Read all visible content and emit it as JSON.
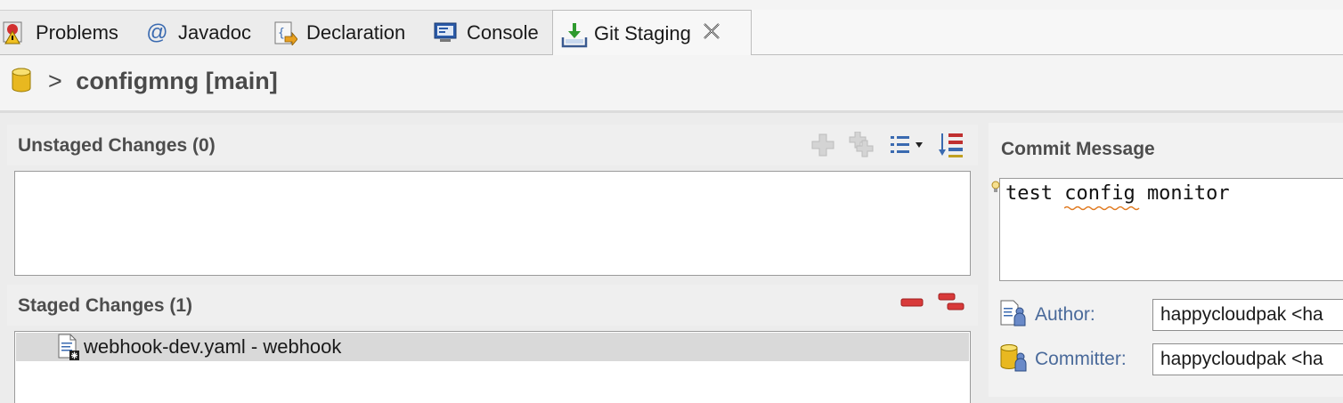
{
  "tabs": [
    {
      "label": "Problems",
      "icon": "problems-icon"
    },
    {
      "label": "Javadoc",
      "icon": "at-icon"
    },
    {
      "label": "Declaration",
      "icon": "declaration-icon"
    },
    {
      "label": "Console",
      "icon": "console-icon"
    },
    {
      "label": "Git Staging",
      "icon": "git-staging-icon",
      "active": true
    }
  ],
  "repository": {
    "arrow": ">",
    "title": "configmng [main]"
  },
  "unstaged": {
    "title": "Unstaged Changes (0)"
  },
  "staged": {
    "title": "Staged Changes (1)",
    "files": [
      {
        "label": "webhook-dev.yaml - webhook"
      }
    ]
  },
  "commit": {
    "title": "Commit Message",
    "message": "test config monitor",
    "author_label": "Author:",
    "author_value": "happycloudpak <ha",
    "committer_label": "Committer:",
    "committer_value": "happycloudpak <ha"
  },
  "colors": {
    "accent_red": "#cc3333",
    "label_blue": "#4a6a9a"
  }
}
